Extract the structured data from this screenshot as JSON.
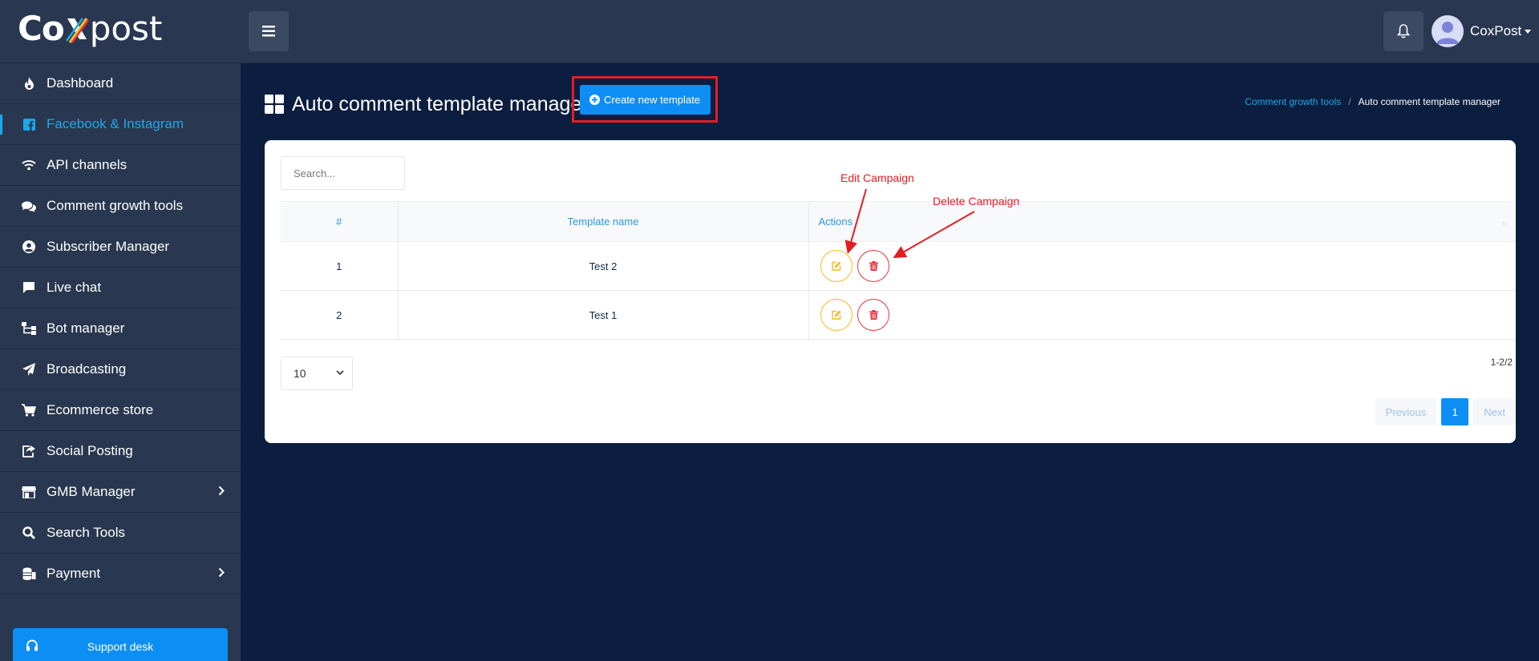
{
  "header": {
    "logo_text_left": "Co",
    "logo_text_right": "post",
    "user_name": "CoxPost"
  },
  "sidebar": {
    "items": [
      {
        "label": "Dashboard",
        "icon": "fire-icon",
        "active": false
      },
      {
        "label": "Facebook & Instagram",
        "icon": "facebook-icon",
        "active": true
      },
      {
        "label": "API channels",
        "icon": "wifi-icon",
        "active": false
      },
      {
        "label": "Comment growth tools",
        "icon": "comments-icon",
        "active": false
      },
      {
        "label": "Subscriber Manager",
        "icon": "user-circle-icon",
        "active": false
      },
      {
        "label": "Live chat",
        "icon": "chat-icon",
        "active": false
      },
      {
        "label": "Bot manager",
        "icon": "sitemap-icon",
        "active": false
      },
      {
        "label": "Broadcasting",
        "icon": "paper-plane-icon",
        "active": false
      },
      {
        "label": "Ecommerce store",
        "icon": "cart-icon",
        "active": false
      },
      {
        "label": "Social Posting",
        "icon": "share-square-icon",
        "active": false
      },
      {
        "label": "GMB Manager",
        "icon": "store-icon",
        "active": false
      },
      {
        "label": "Search Tools",
        "icon": "search-icon",
        "active": false
      },
      {
        "label": "Payment",
        "icon": "coins-icon",
        "active": false
      }
    ],
    "support_label": "Support desk"
  },
  "page": {
    "title": "Auto comment template manager",
    "create_button": "Create new template",
    "breadcrumb": {
      "parent": "Comment growth tools",
      "separator": "/",
      "current": "Auto comment template manager"
    }
  },
  "table": {
    "search_placeholder": "Search...",
    "columns": [
      "#",
      "Template name",
      "Actions"
    ],
    "rows": [
      {
        "index": "1",
        "name": "Test 2"
      },
      {
        "index": "2",
        "name": "Test 1"
      }
    ],
    "per_page": "10",
    "range": "1-2/2",
    "pager": {
      "previous": "Previous",
      "current": "1",
      "next": "Next"
    }
  },
  "annotations": {
    "edit": "Edit Campaign",
    "delete": "Delete Campaign"
  },
  "colors": {
    "background": "#0c1e3f",
    "panel": "#293850",
    "accent": "#0d8ef5",
    "edit": "#f7b924",
    "delete": "#e8303f",
    "annotation": "#e41c23"
  }
}
